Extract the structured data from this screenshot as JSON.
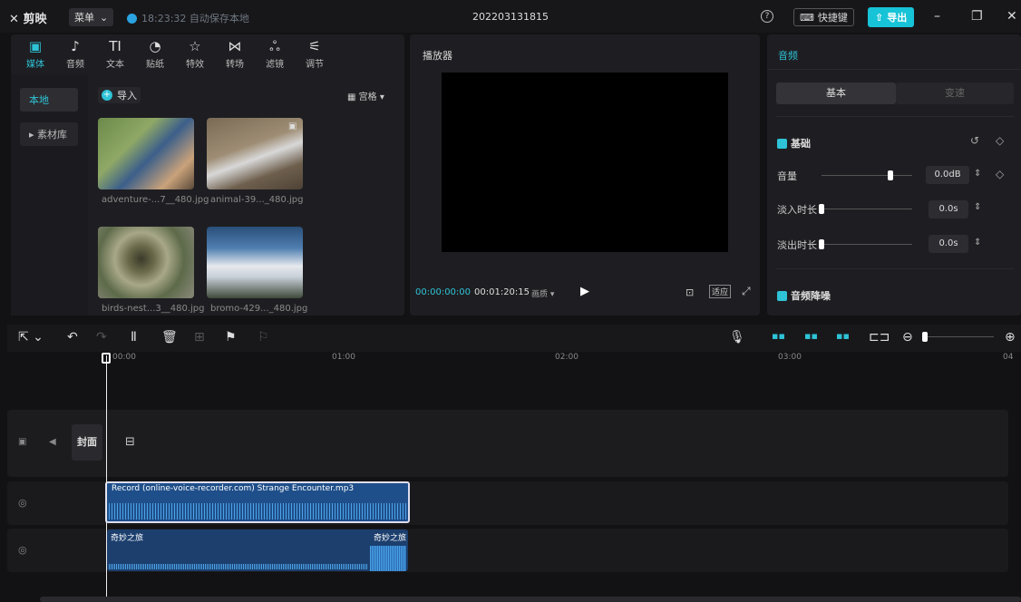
{
  "app": {
    "logo": "剪映",
    "menu_label": "菜单",
    "save_status": "18:23:32 自动保存本地",
    "project_title": "202203131815",
    "shortcut_label": "快捷键",
    "export_label": "导出"
  },
  "media_tabs": [
    {
      "label": "媒体",
      "icon": "▣"
    },
    {
      "label": "音频",
      "icon": "♪"
    },
    {
      "label": "文本",
      "icon": "TI"
    },
    {
      "label": "贴纸",
      "icon": "◔"
    },
    {
      "label": "特效",
      "icon": "☆"
    },
    {
      "label": "转场",
      "icon": "⋈"
    },
    {
      "label": "滤镜",
      "icon": "ஃ"
    },
    {
      "label": "调节",
      "icon": "⚟"
    }
  ],
  "media_sidebar": {
    "local": "本地",
    "library": "▸ 素材库"
  },
  "media_toolbar": {
    "import": "导入",
    "view": "宫格"
  },
  "media_items": [
    {
      "label": "adventure-...7__480.jpg"
    },
    {
      "label": "animal-39..._480.jpg"
    },
    {
      "label": "birds-nest...3__480.jpg"
    },
    {
      "label": "bromo-429..._480.jpg"
    }
  ],
  "player": {
    "title": "播放器",
    "current_time": "00:00:00:00",
    "total_time": "00:01:20:15",
    "quality": "画质",
    "fit": "适应"
  },
  "audio_panel": {
    "title": "音频",
    "tab_basic": "基本",
    "tab_speed": "变速",
    "section_basic": "基础",
    "volume_label": "音量",
    "volume_value": "0.0dB",
    "fadein_label": "淡入时长",
    "fadein_value": "0.0s",
    "fadeout_label": "淡出时长",
    "fadeout_value": "0.0s",
    "denoise_label": "音频降噪"
  },
  "timeline": {
    "ruler": [
      "00:00",
      "01:00",
      "02:00",
      "03:00",
      "04"
    ],
    "cover_label": "封面",
    "audio_clip_name": "Record (online-voice-recorder.com) Strange Encounter.mp3",
    "music_clip_name": "奇妙之旅",
    "music_clip_name_end": "奇妙之旅"
  },
  "colors": {
    "accent": "#2ec3d6",
    "clip_blue": "#1f4f8a"
  }
}
